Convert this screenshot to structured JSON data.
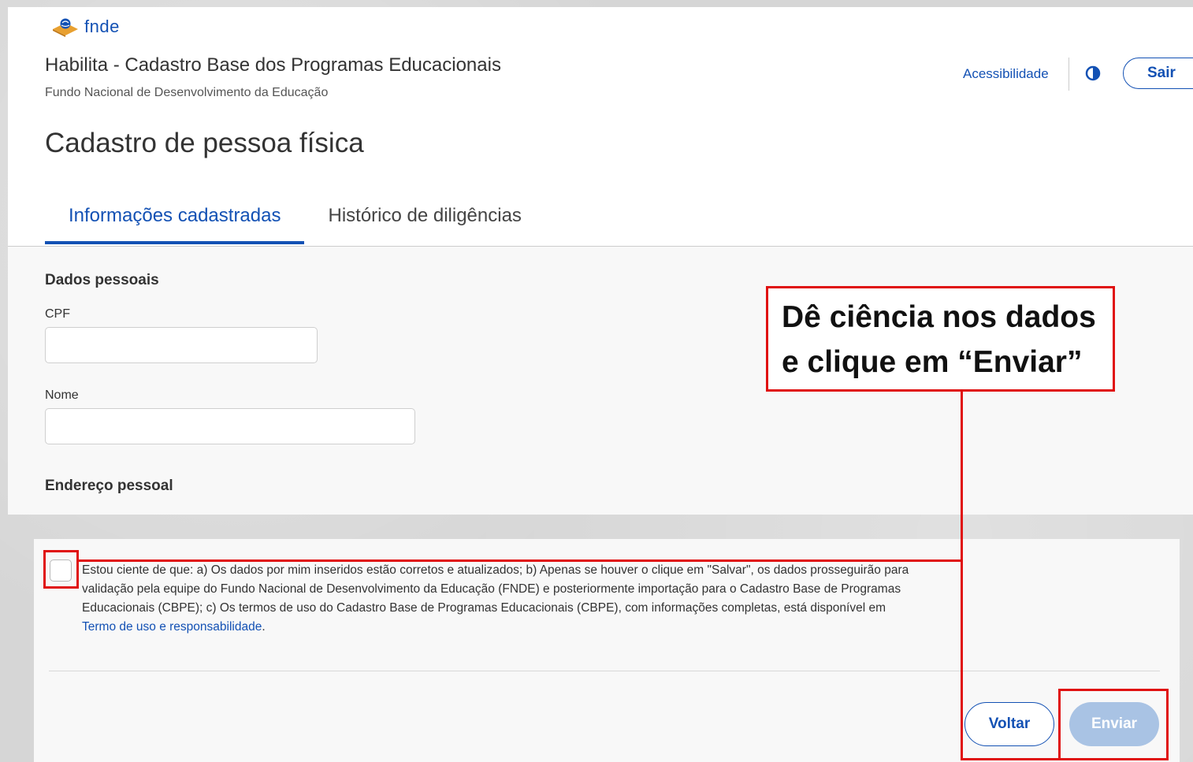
{
  "header": {
    "logo_text": "fnde",
    "app_title": "Habilita - Cadastro Base dos Programas Educacionais",
    "app_subtitle": "Fundo Nacional de Desenvolvimento da Educação",
    "accessibility_label": "Acessibilidade",
    "contrast_icon": "contrast-icon",
    "logout_label": "Sair"
  },
  "page": {
    "title": "Cadastro de pessoa física",
    "tabs": [
      {
        "label": "Informações cadastradas",
        "active": true
      },
      {
        "label": "Histórico de diligências",
        "active": false
      }
    ]
  },
  "form": {
    "section_personal": "Dados pessoais",
    "cpf_label": "CPF",
    "cpf_value": "",
    "name_label": "Nome",
    "name_value": "",
    "section_address": "Endereço pessoal"
  },
  "consent": {
    "checked": false,
    "text": "Estou ciente de que: a) Os dados por mim inseridos estão corretos e atualizados; b) Apenas se houver o clique em \"Salvar\", os dados prosseguirão para validação pela equipe do Fundo Nacional de Desenvolvimento da Educação (FNDE) e posteriormente importação para o Cadastro Base de Programas Educacionais (CBPE); c) Os termos de uso do Cadastro Base de Programas Educacionais (CBPE), com informações completas, está disponível em ",
    "link_label": "Termo de uso e responsabilidade",
    "text_end": "."
  },
  "actions": {
    "back_label": "Voltar",
    "submit_label": "Enviar",
    "submit_enabled": false
  },
  "annotation": {
    "line1": "Dê ciência nos dados",
    "line2": "e clique em “Enviar”",
    "color": "#e01010"
  },
  "colors": {
    "brand_blue": "#1351b4",
    "disabled_button": "#a9c3e4"
  }
}
